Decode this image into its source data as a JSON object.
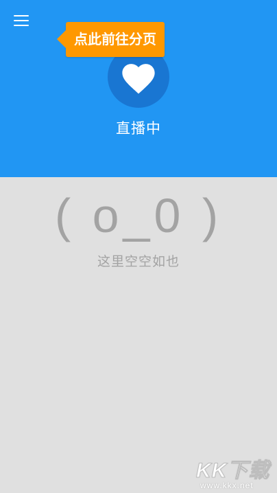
{
  "header": {
    "menu_icon": "menu-icon",
    "favorite_icon": "heart-icon",
    "live_label": "直播中",
    "background_color": "#2196f3",
    "circle_color": "#1976d2"
  },
  "tooltip": {
    "text": "点此前往分页",
    "color": "#ff9800"
  },
  "empty_state": {
    "face": "( o_0 )",
    "message": "这里空空如也"
  },
  "watermark": {
    "logo": "KK下载",
    "url": "www.kkx.net"
  }
}
